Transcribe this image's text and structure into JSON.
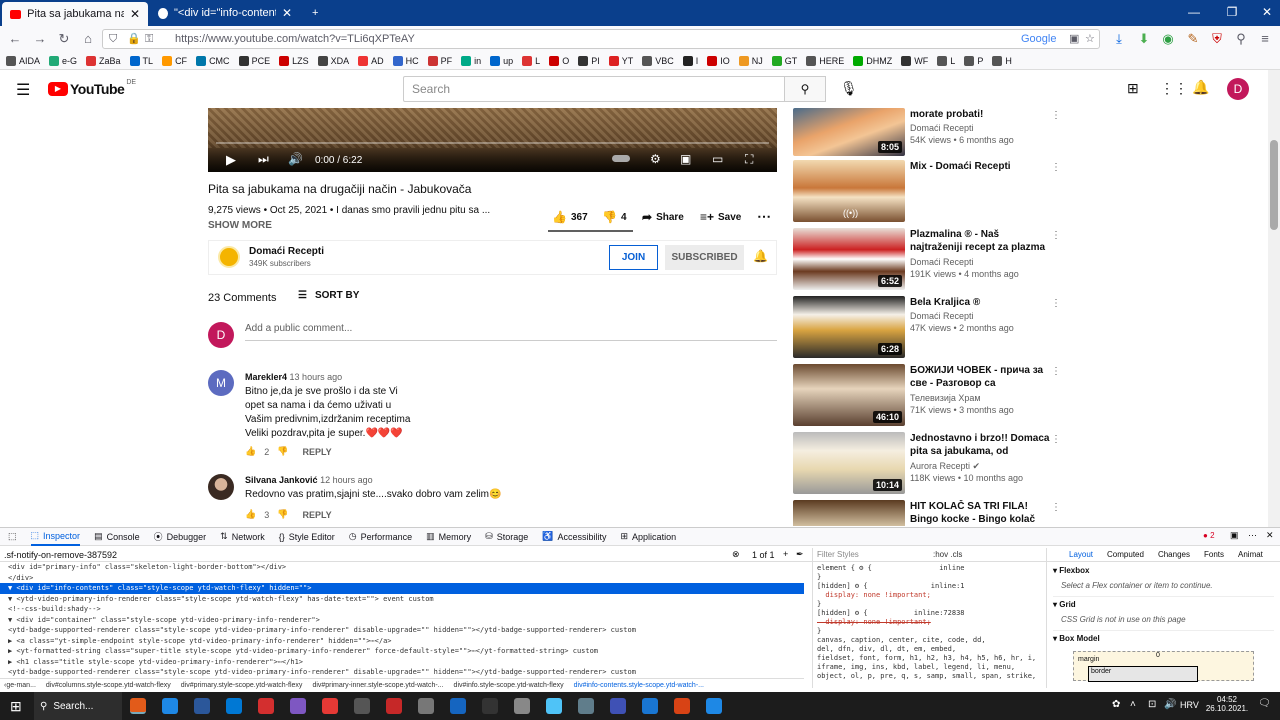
{
  "browser": {
    "tabs": [
      {
        "title": "Pita sa jabukama na drugačiji n"
      },
      {
        "title": "\"<div id=\"info-contents\" class"
      }
    ],
    "url": "https://www.youtube.com/watch?v=TLi6qXPTeAY",
    "google_label": "Google",
    "bookmarks": [
      "AIDA",
      "e-G",
      "ZaBa",
      "TL",
      "CF",
      "CMC",
      "PCE",
      "LZS",
      "XDA",
      "AD",
      "HC",
      "PF",
      "in",
      "up",
      "L",
      "O",
      "PI",
      "YT",
      "VBC",
      "I",
      "IO",
      "NJ",
      "GT",
      "HERE",
      "DHMZ",
      "WF",
      "L",
      "P",
      "H"
    ]
  },
  "youtube": {
    "logo": "YouTube",
    "region": "DE",
    "search_placeholder": "Search",
    "avatar_letter": "D"
  },
  "video": {
    "time": "0:00 / 6:22",
    "title": "Pita sa jabukama na drugačiji način - Jabukovača",
    "meta": "9,275 views • Oct 25, 2021 • I danas smo pravili jednu pitu sa ...",
    "show_more": "SHOW MORE",
    "likes": "367",
    "dislikes": "4",
    "share": "Share",
    "save": "Save"
  },
  "channel": {
    "name": "Domaći Recepti",
    "subscribers": "349K subscribers",
    "join": "JOIN",
    "subscribed": "SUBSCRIBED"
  },
  "comments": {
    "count": "23 Comments",
    "sort": "SORT BY",
    "add_placeholder": "Add a public comment...",
    "items": [
      {
        "author": "Marekler4",
        "time": "13 hours ago",
        "lines": [
          "Bitno je,da je sve prošlo i da ste Vi",
          "opet sa nama i da ćemo uživati u",
          "Vašim predivnim,izdržanim receptima",
          "Veliki pozdrav,pita je super.❤️❤️❤️"
        ],
        "likes": "2",
        "reply": "REPLY",
        "avatar": "M"
      },
      {
        "author": "Silvana Janković",
        "time": "12 hours ago",
        "lines": [
          "Redovno vas pratim,sjajni ste....svako dobro vam zelim😊"
        ],
        "likes": "3",
        "reply": "REPLY"
      }
    ]
  },
  "sidebar": [
    {
      "title": "morate probati!",
      "channel": "Domaći Recepti",
      "meta": "54K views • 6 months ago",
      "duration": "8:05"
    },
    {
      "title": "Mix - Domaći Recepti",
      "channel": "",
      "meta": "",
      "duration": ""
    },
    {
      "title": "Plazmalina ® - Naš najtraženiji recept za plazma tortu sa...",
      "channel": "Domaći Recepti",
      "meta": "191K views • 4 months ago",
      "duration": "6:52"
    },
    {
      "title": "Bela Kraljica ®",
      "channel": "Domaći Recepti",
      "meta": "47K views • 2 months ago",
      "duration": "6:28"
    },
    {
      "title": "БОЖИЈИ ЧОВЕК - прича за све - Разговор са режисеро...",
      "channel": "Телевизија Храм",
      "meta": "71K views • 3 months ago",
      "duration": "46:10"
    },
    {
      "title": "Jednostavno i brzo!! Domaca pita sa jabukama, od domaci...",
      "channel": "Aurora Recepti ✔",
      "meta": "118K views • 10 months ago",
      "duration": "10:14"
    },
    {
      "title": "HIT KOLAČ SA TRI FILA! Bingo kocke - Bingo kolač",
      "channel": "",
      "meta": "",
      "duration": ""
    }
  ],
  "devtools": {
    "tabs": [
      "Inspector",
      "Console",
      "Debugger",
      "Network",
      "Style Editor",
      "Performance",
      "Memory",
      "Storage",
      "Accessibility",
      "Application"
    ],
    "search": ".sf-notify-on-remove-387592",
    "match_count": "1 of 1",
    "errors": "2",
    "html_lines": [
      "<div id=\"primary-info\" class=\"skeleton-light-border-bottom\"></div>",
      "</div>",
      "▼ <div id=\"info-contents\" class=\"style-scope ytd-watch-flexy\" hidden=\"\">",
      "  ▼ <ytd-video-primary-info-renderer class=\"style-scope ytd-watch-flexy\" has-date-text=\"\"> event custom",
      "      <!--css-build:shady-->",
      "    ▼ <div id=\"container\" class=\"style-scope ytd-video-primary-info-renderer\">",
      "        <ytd-badge-supported-renderer class=\"style-scope ytd-video-primary-info-renderer\" disable-upgrade=\"\" hidden=\"\"></ytd-badge-supported-renderer> custom",
      "      ▶ <a class=\"yt-simple-endpoint style-scope ytd-video-primary-info-renderer\" hidden=\"\">⋯</a>",
      "      ▶ <yt-formatted-string class=\"super-title style-scope ytd-video-primary-info-renderer\" force-default-style=\"\">⋯</yt-formatted-string> custom",
      "      ▶ <h1 class=\"title style-scope ytd-video-primary-info-renderer\">⋯</h1>",
      "        <ytd-badge-supported-renderer class=\"style-scope ytd-video-primary-info-renderer\" disable-upgrade=\"\" hidden=\"\"></ytd-badge-supported-renderer> custom"
    ],
    "styles_filter": "Filter Styles",
    "styles_flags": ":hov .cls",
    "styles_lines": [
      "element { ⚙ {                inline",
      "}",
      "[hidden] ⚙ {               inline:1",
      "  display: none !important;",
      "}",
      "[hidden] ⚙ {           inline:72838",
      "  display: none !important;",
      "}",
      "canvas, caption, center, cite, code, dd,",
      "del, dfn, div, dl, dt, em, embed,",
      "fieldset, font, form, h1, h2, h3, h4, h5, h6, hr, i,",
      "iframe, img, ins, kbd, label, legend, li, menu,",
      "object, ol, p, pre, q, s, samp, small, span, strike,"
    ],
    "layout_tabs": [
      "Layout",
      "Computed",
      "Changes",
      "Fonts",
      "Animat"
    ],
    "flexbox": "Flexbox",
    "flexbox_msg": "Select a Flex container or item to continue.",
    "grid": "Grid",
    "grid_msg": "CSS Grid is not in use on this page",
    "boxmodel": "Box Model",
    "margin": "margin",
    "border": "border",
    "zero": "0",
    "crumbs": [
      "‹ge-man...",
      "div#columns.style-scope.ytd-watch-flexy",
      "div#primary.style-scope.ytd-watch-flexy",
      "div#primary-inner.style-scope.ytd-watch-...",
      "div#info.style-scope.ytd-watch-flexy",
      "div#info-contents.style-scope.ytd-watch-..."
    ]
  },
  "taskbar": {
    "search": "Search...",
    "lang": "HRV",
    "time": "04:52",
    "date": "26.10.2021."
  }
}
